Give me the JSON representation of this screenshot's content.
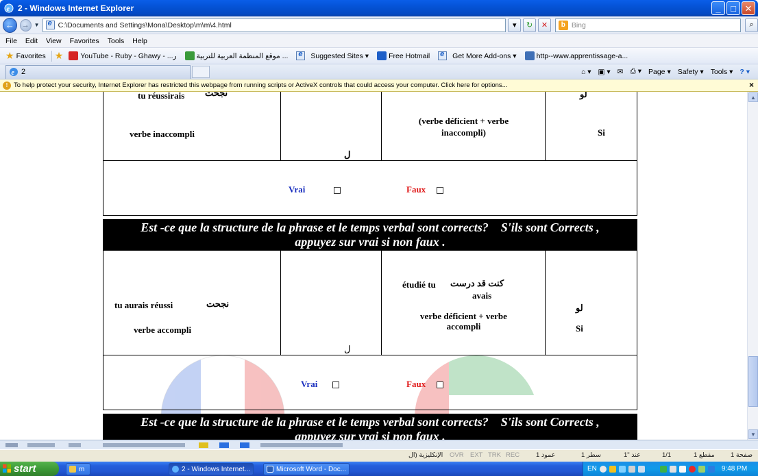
{
  "window": {
    "title": "2 - Windows Internet Explorer",
    "address": "C:\\Documents and Settings\\Mona\\Desktop\\m\\m\\4.html",
    "search_placeholder": "Bing"
  },
  "menu": [
    "File",
    "Edit",
    "View",
    "Favorites",
    "Tools",
    "Help"
  ],
  "favorites": {
    "label": "Favorites",
    "items": [
      "YouTube - Ruby - Ghawy - ...ر",
      "موقع المنظمة العربية للتربية ...",
      "Suggested Sites ▾",
      "Free Hotmail",
      "Get More Add-ons ▾",
      "http--www.apprentissage-a..."
    ]
  },
  "tab": {
    "title": "2"
  },
  "command_bar": [
    "Page ▾",
    "Safety ▾",
    "Tools ▾"
  ],
  "infobar": {
    "text": "To help protect your security, Internet Explorer has restricted this webpage from running scripts or ActiveX controls that could access your computer. Click here for options..."
  },
  "doc": {
    "row1": {
      "col1_top": "tu réussirais",
      "col1_arabic": "نجحت",
      "col1_bottom": "verbe inaccompli",
      "col2": "ل",
      "col3": "(verbe déficient + verbe inaccompli)",
      "col4_arabic": "لو",
      "col4": "Si"
    },
    "vrai": "Vrai",
    "faux": "Faux",
    "banner_line1": "Est -ce que la structure de la phrase et le temps verbal sont corrects?    S'ils sont Corrects ,",
    "banner_line2": "appuyez sur vrai si non faux .",
    "row2": {
      "col1_top": "tu aurais réussi",
      "col1_arabic": "نجحت",
      "col1_bottom": "verbe accompli",
      "col2": "ل",
      "col3_arabic": "كنت قد درست",
      "col3_top": "étudié tu",
      "col3_mid": "avais",
      "col3_bottom": "verbe déficient + verbe accompli",
      "col4_arabic": "لو",
      "col4": "Si"
    }
  },
  "word_status": {
    "page": "صفحة 1",
    "section": "مقطع 1",
    "pages": "1/1",
    "at": "عند \"1",
    "line": "سطر 1",
    "col": "عمود 1",
    "rec": "REC",
    "trk": "TRK",
    "ext": "EXT",
    "ovr": "OVR",
    "lang": "الإنكليزية (ال"
  },
  "taskbar": {
    "start": "start",
    "buttons": [
      "m",
      "2 - Windows Internet...",
      "Microsoft Word - Doc..."
    ],
    "lang": "EN",
    "clock": "9:48 PM"
  },
  "colors": {
    "vrai": "#1a2fbf",
    "faux": "#e01b1b"
  }
}
